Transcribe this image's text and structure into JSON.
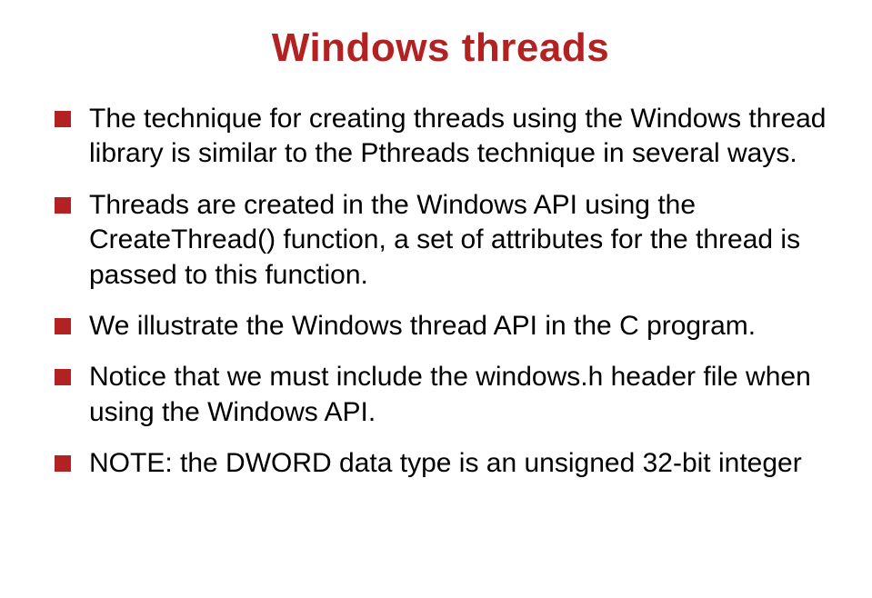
{
  "title": "Windows threads",
  "bullets": [
    "The technique for creating threads using the Windows thread library is similar to the Pthreads technique in several ways.",
    "Threads are created in the Windows API using the CreateThread() function, a set of attributes for the thread is passed to this function.",
    "We illustrate the Windows thread API in the C program.",
    "Notice that we must include the windows.h header file when using the Windows API.",
    "NOTE: the DWORD data type is an unsigned 32-bit integer"
  ]
}
